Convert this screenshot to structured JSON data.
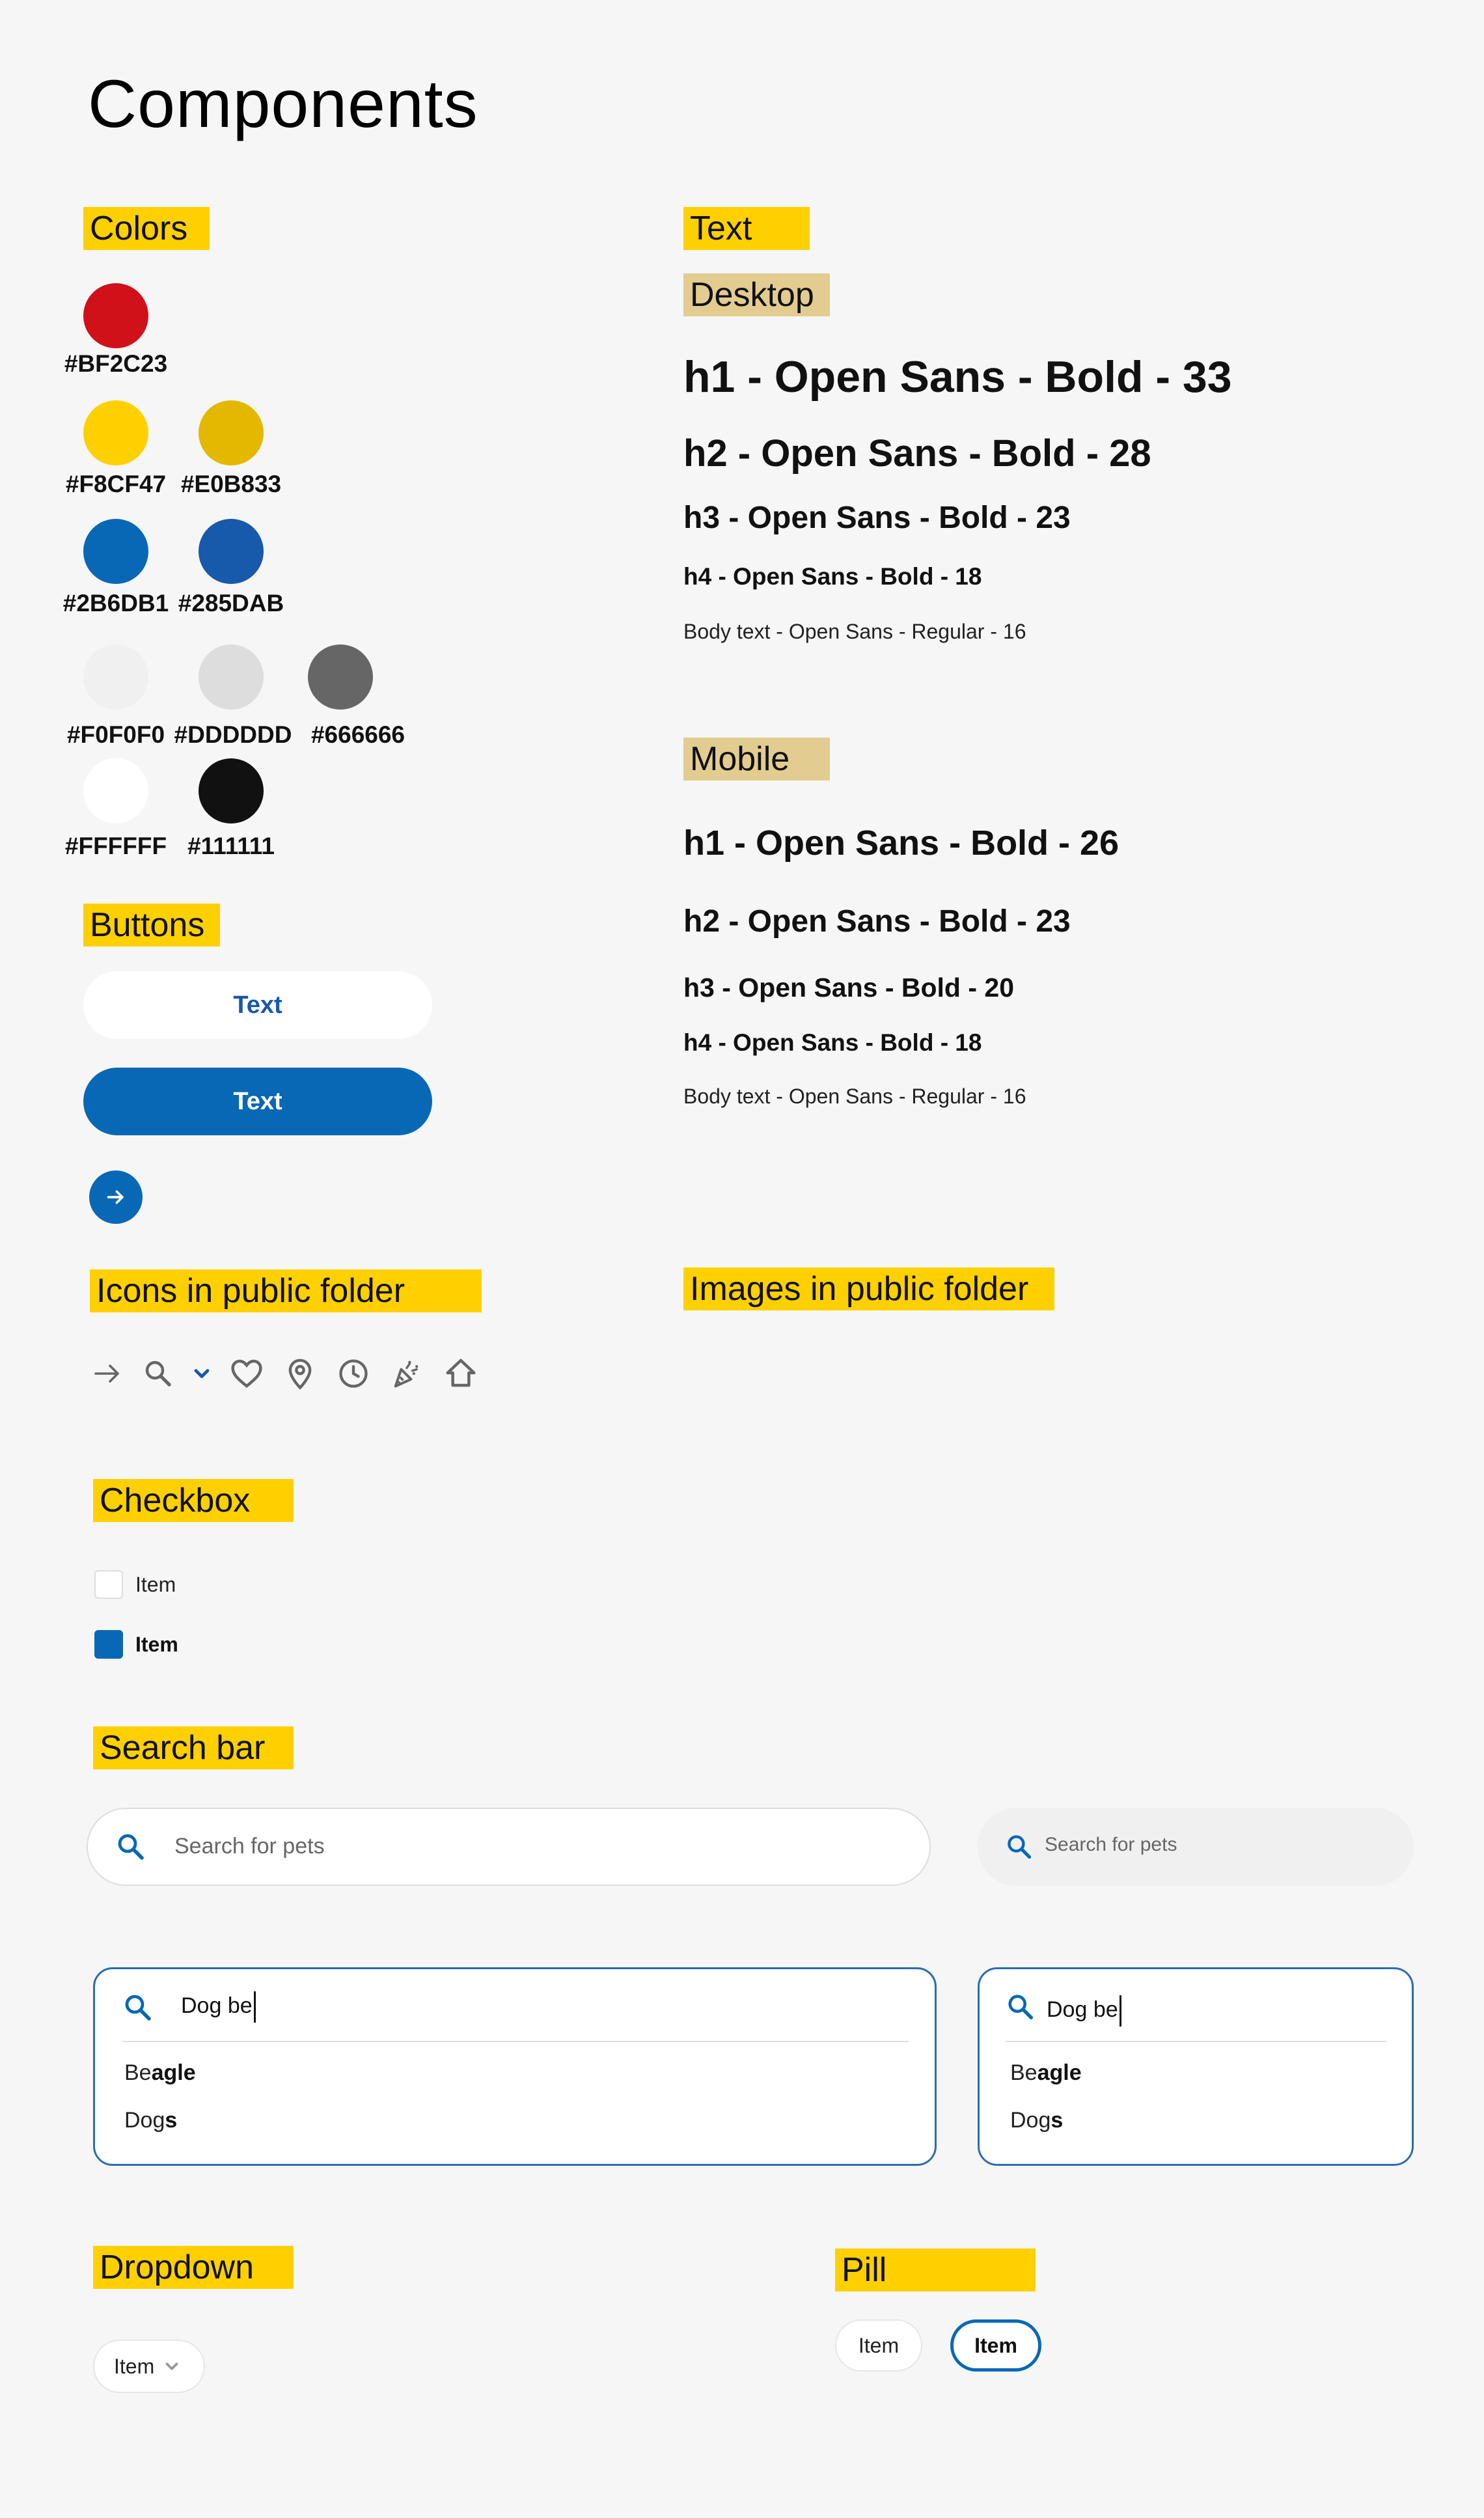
{
  "page": {
    "title": "Components"
  },
  "sections": {
    "colors": "Colors",
    "text": "Text",
    "desktop": "Desktop",
    "mobile": "Mobile",
    "buttons": "Buttons",
    "icons": "Icons in public folder",
    "images": "Images in public folder",
    "checkbox": "Checkbox",
    "search": "Search bar",
    "dropdown": "Dropdown",
    "pill": "Pill"
  },
  "colors": [
    {
      "hex": "#BF2C23",
      "label": "#BF2C23"
    },
    {
      "hex": "#F8CF47",
      "label": "#F8CF47"
    },
    {
      "hex": "#E0B833",
      "label": "#E0B833"
    },
    {
      "hex": "#2B6DB1",
      "label": "#2B6DB1"
    },
    {
      "hex": "#285DAB",
      "label": "#285DAB"
    },
    {
      "hex": "#F0F0F0",
      "label": "#F0F0F0"
    },
    {
      "hex": "#DDDDDD",
      "label": "#DDDDDD"
    },
    {
      "hex": "#666666",
      "label": "#666666"
    },
    {
      "hex": "#FFFFFF",
      "label": "#FFFFFF"
    },
    {
      "hex": "#111111",
      "label": "#111111"
    }
  ],
  "typography": {
    "desktop": {
      "h1": "h1 - Open Sans - Bold - 33",
      "h2": "h2 - Open Sans - Bold - 28",
      "h3": "h3 - Open Sans - Bold - 23",
      "h4": "h4 - Open Sans - Bold - 18",
      "body": "Body text - Open Sans - Regular - 16"
    },
    "mobile": {
      "h1": "h1 - Open Sans - Bold - 26",
      "h2": "h2 - Open Sans - Bold - 23",
      "h3": "h3 - Open Sans - Bold - 20",
      "h4": "h4 - Open Sans - Bold - 18",
      "body": "Body text - Open Sans - Regular - 16"
    }
  },
  "buttons": {
    "outline_label": "Text",
    "filled_label": "Text",
    "circle_icon": "arrow-right-icon"
  },
  "icons": [
    "arrow-right-icon",
    "search-icon",
    "chevron-down-icon",
    "heart-icon",
    "map-pin-icon",
    "clock-icon",
    "party-popper-icon",
    "home-icon"
  ],
  "checkbox": {
    "items": [
      {
        "label": "Item",
        "checked": false
      },
      {
        "label": "Item",
        "checked": true
      }
    ]
  },
  "search": {
    "placeholder": "Search for pets",
    "query": "Dog be",
    "suggestions": [
      {
        "match": "Be",
        "rest": "agle"
      },
      {
        "match": "Dog",
        "rest": "s"
      }
    ]
  },
  "dropdown": {
    "selected": "Item"
  },
  "pills": [
    {
      "label": "Item",
      "selected": false
    },
    {
      "label": "Item",
      "selected": true
    }
  ],
  "accent_colors": {
    "primary": "#0868B5",
    "highlight": "#FFD000",
    "khaki": "#E2CC90"
  }
}
